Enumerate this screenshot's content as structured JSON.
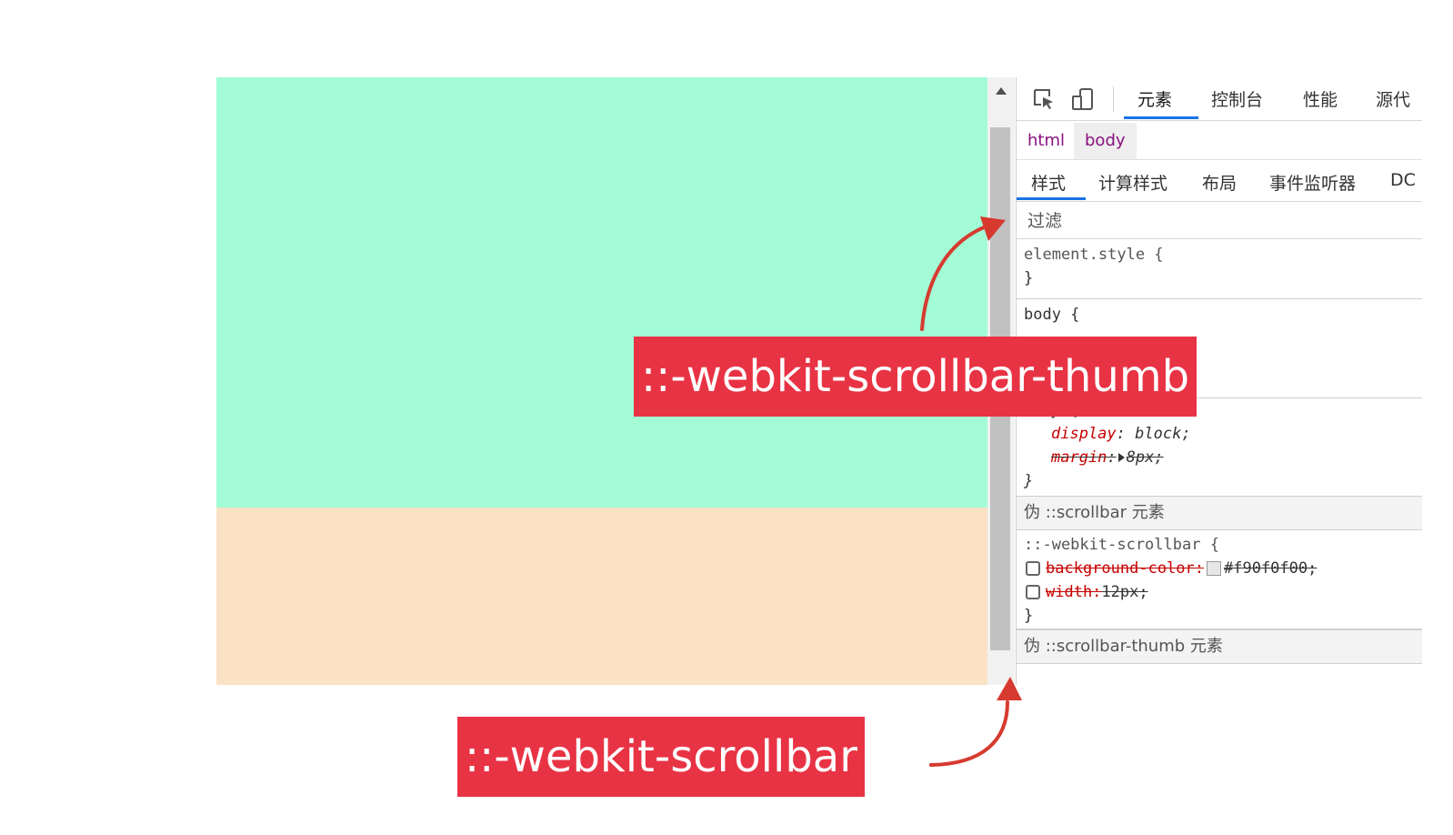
{
  "devtools": {
    "tabs": [
      "元素",
      "控制台",
      "性能",
      "源代"
    ],
    "breadcrumbs": [
      "html",
      "body"
    ],
    "subtabs": [
      "样式",
      "计算样式",
      "布局",
      "事件监听器",
      "DC"
    ],
    "filter_placeholder": "过滤",
    "rules": {
      "element_style": {
        "selector": "element.style {",
        "close": "}"
      },
      "body_author": {
        "selector": "body {"
      },
      "body_ua": {
        "selector": "body {",
        "props": [
          {
            "name": "display",
            "value": "block;"
          },
          {
            "name": "margin",
            "value": "8px;"
          }
        ],
        "close": "}"
      },
      "scrollbar_section": "伪 ::scrollbar 元素",
      "scrollbar_rule": {
        "selector": "::-webkit-scrollbar {",
        "props": [
          {
            "name": "background-color:",
            "value": "#f90f0f00;"
          },
          {
            "name": "width:",
            "value": "12px;"
          }
        ],
        "close": "}"
      },
      "thumb_section": "伪 ::scrollbar-thumb 元素"
    }
  },
  "annotations": {
    "thumb_label": "::-webkit-scrollbar-thumb",
    "scrollbar_label": "::-webkit-scrollbar"
  },
  "colors": {
    "preview_top": "#a3fcd6",
    "preview_bottom": "#fbe2c5",
    "annotation_bg": "#e83344",
    "arrow": "#d63a2f",
    "accent": "#1a73e8"
  }
}
